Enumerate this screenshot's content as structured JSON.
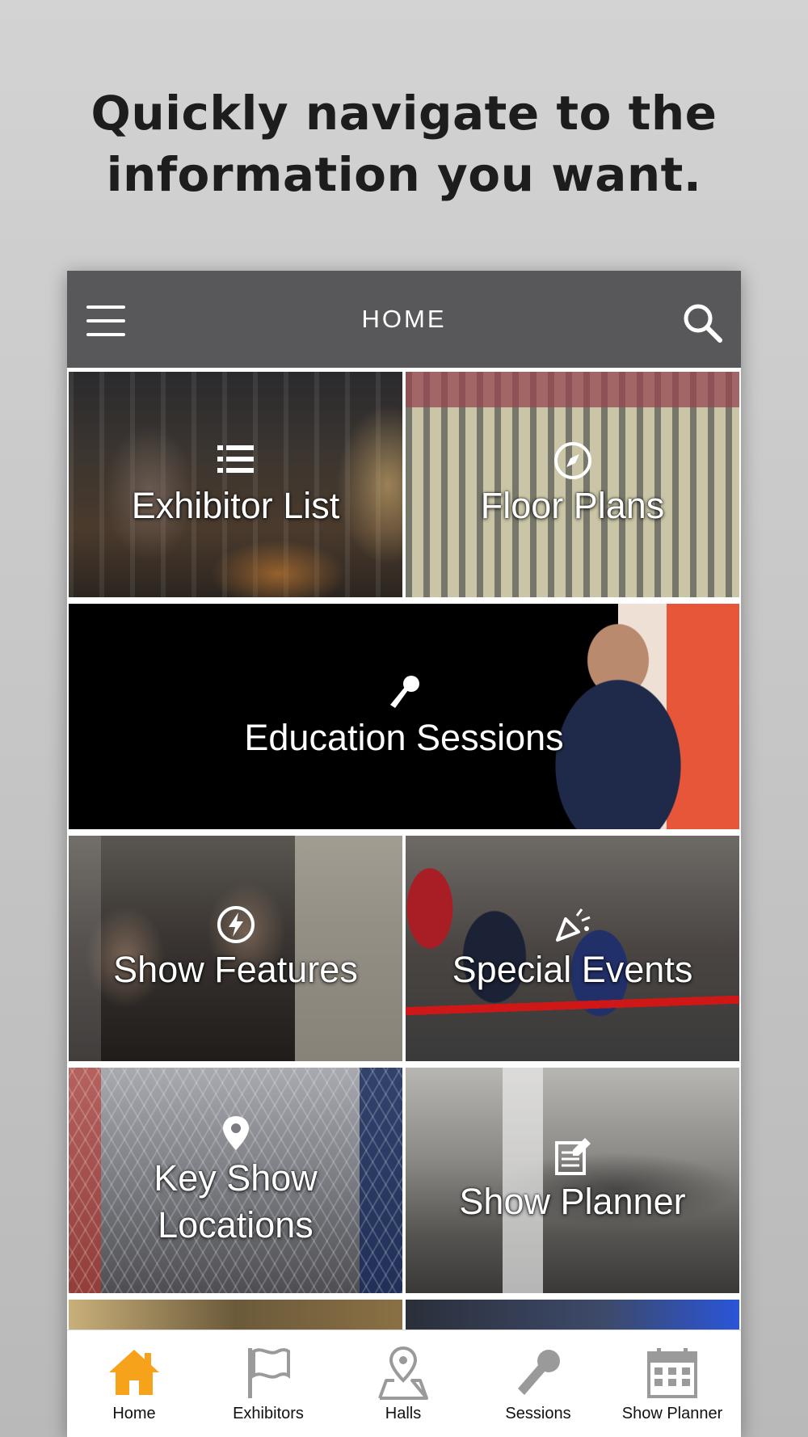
{
  "headline": {
    "line1": "Quickly navigate to the",
    "line2": "information you want."
  },
  "appbar": {
    "title": "HOME",
    "menu_icon": "hamburger-menu-icon",
    "search_icon": "search-icon"
  },
  "tiles": [
    {
      "label": "Exhibitor List",
      "icon": "list-icon"
    },
    {
      "label": "Floor Plans",
      "icon": "compass-icon"
    },
    {
      "label": "Education Sessions",
      "icon": "microphone-icon"
    },
    {
      "label": "Show Features",
      "icon": "lightning-icon"
    },
    {
      "label": "Special Events",
      "icon": "party-popper-icon"
    },
    {
      "label": "Key Show\nLocations",
      "icon": "map-pin-icon"
    },
    {
      "label": "Show Planner",
      "icon": "notepad-icon"
    }
  ],
  "tabbar": {
    "active_color": "#f6a21b",
    "inactive_color": "#9a9a9a",
    "items": [
      {
        "label": "Home",
        "icon": "home-icon",
        "active": true
      },
      {
        "label": "Exhibitors",
        "icon": "flag-icon",
        "active": false
      },
      {
        "label": "Halls",
        "icon": "map-marker-icon",
        "active": false
      },
      {
        "label": "Sessions",
        "icon": "microphone-icon",
        "active": false
      },
      {
        "label": "Show Planner",
        "icon": "calendar-icon",
        "active": false
      }
    ]
  }
}
